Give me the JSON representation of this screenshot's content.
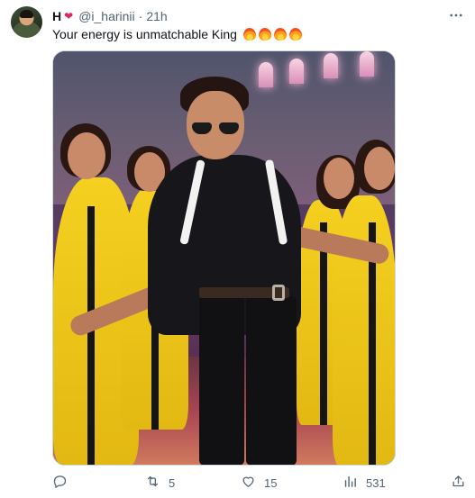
{
  "tweet": {
    "author_name": "H",
    "author_emoji": "❤",
    "handle": "@i_harinii",
    "separator": "·",
    "time": "21h",
    "text": "Your energy is unmatchable King",
    "emojis": [
      "fire",
      "fire",
      "fire",
      "fire"
    ],
    "media": {
      "alt_description_visible": false
    },
    "actions": {
      "reply_count": "",
      "retweet_count": "5",
      "like_count": "15",
      "views_count": "531",
      "share_count": ""
    },
    "icons": {
      "more": "more-icon",
      "reply": "reply-icon",
      "retweet": "retweet-icon",
      "like": "heart-icon",
      "views": "views-icon",
      "share": "share-icon"
    },
    "colors": {
      "text": "#0f1419",
      "secondary": "#536471",
      "border": "#cfd9de"
    }
  }
}
